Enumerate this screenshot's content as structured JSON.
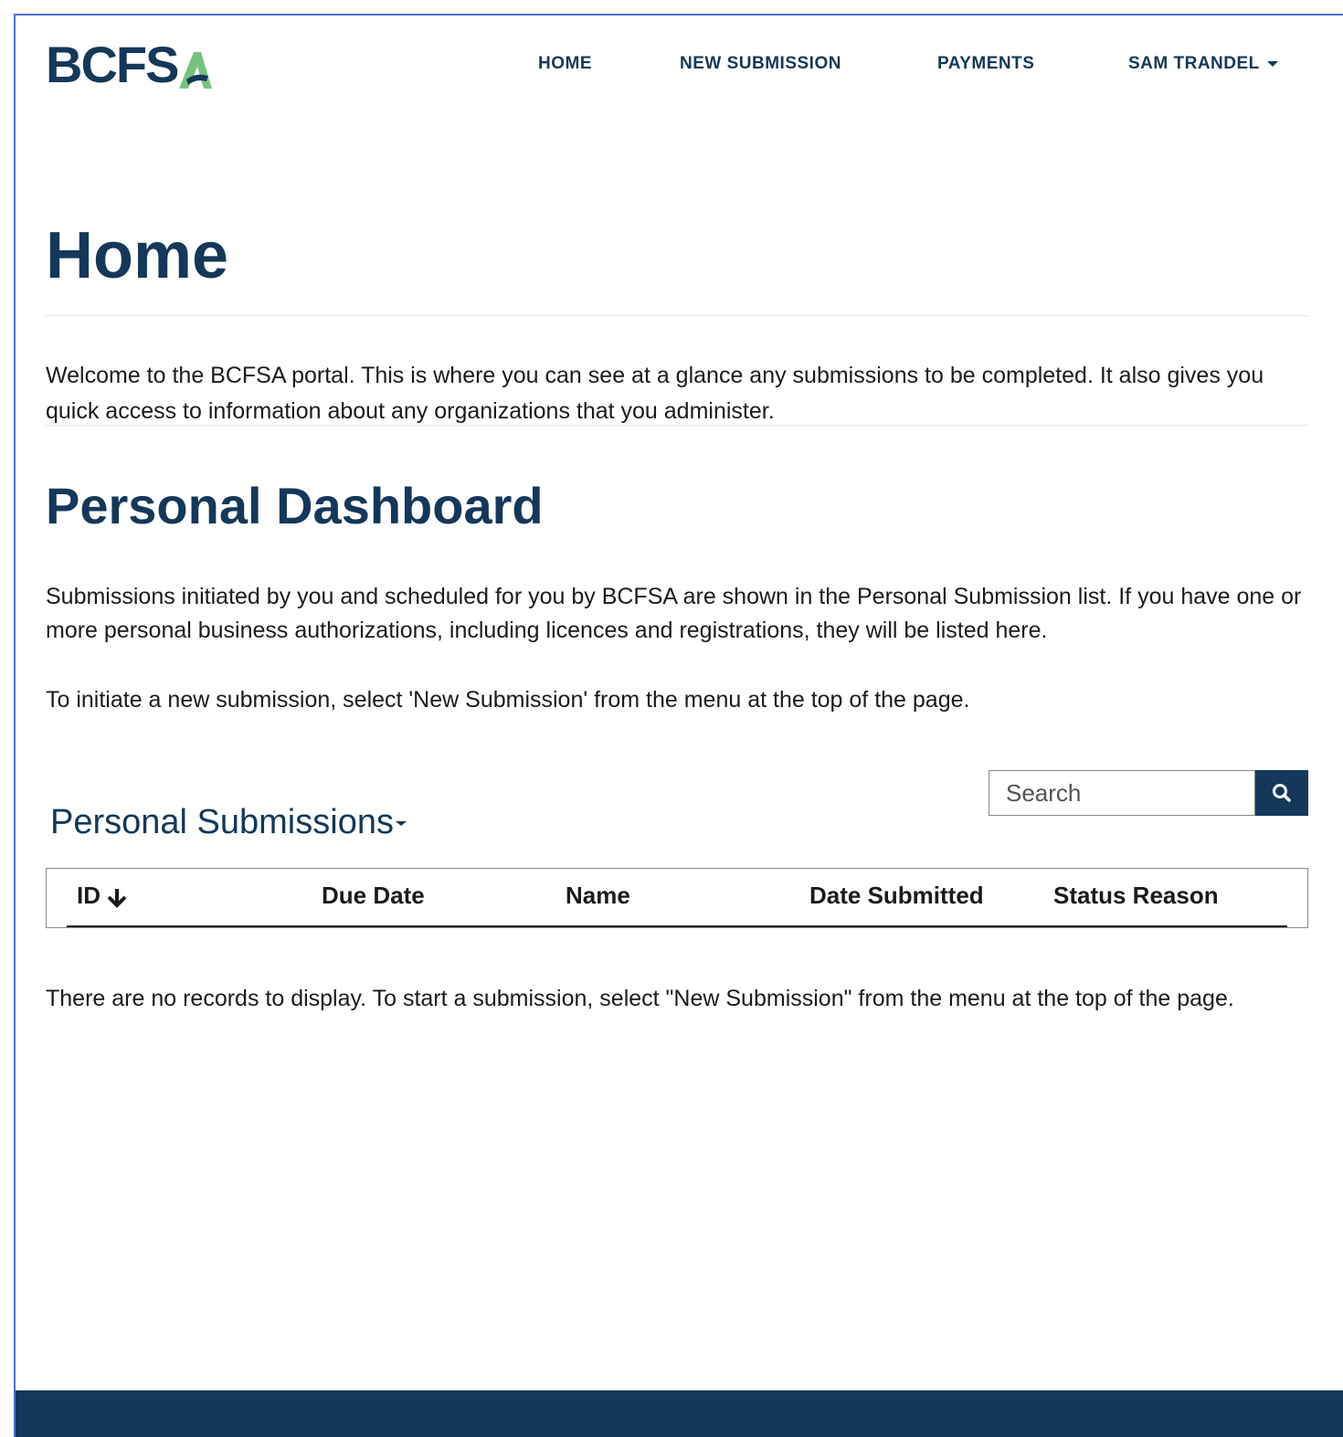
{
  "header": {
    "logo_text": "BCFS",
    "nav": {
      "home": "HOME",
      "new_submission": "NEW SUBMISSION",
      "payments": "PAYMENTS",
      "user": "SAM TRANDEL"
    }
  },
  "page": {
    "title": "Home",
    "welcome": "Welcome to the BCFSA portal. This is where you can see at a glance any submissions to be completed. It also gives you quick access to information about any organizations that you administer.",
    "dashboard_title": "Personal Dashboard",
    "dashboard_p1": "Submissions initiated by you and scheduled for you by BCFSA are shown in the Personal Submission list. If you have one or more personal business authorizations, including licences and registrations, they will be listed here.",
    "dashboard_p2": "To initiate a new submission, select 'New Submission' from the menu at the top of the page."
  },
  "submissions": {
    "title": "Personal Submissions",
    "search_placeholder": "Search",
    "columns": {
      "id": "ID",
      "due_date": "Due Date",
      "name": "Name",
      "date_submitted": "Date Submitted",
      "status_reason": "Status Reason"
    },
    "empty_message": "There are no records to display. To start a submission, select \"New Submission\" from the menu at the top of the page."
  },
  "colors": {
    "brand_navy": "#13385a",
    "logo_green": "#79c27d"
  }
}
